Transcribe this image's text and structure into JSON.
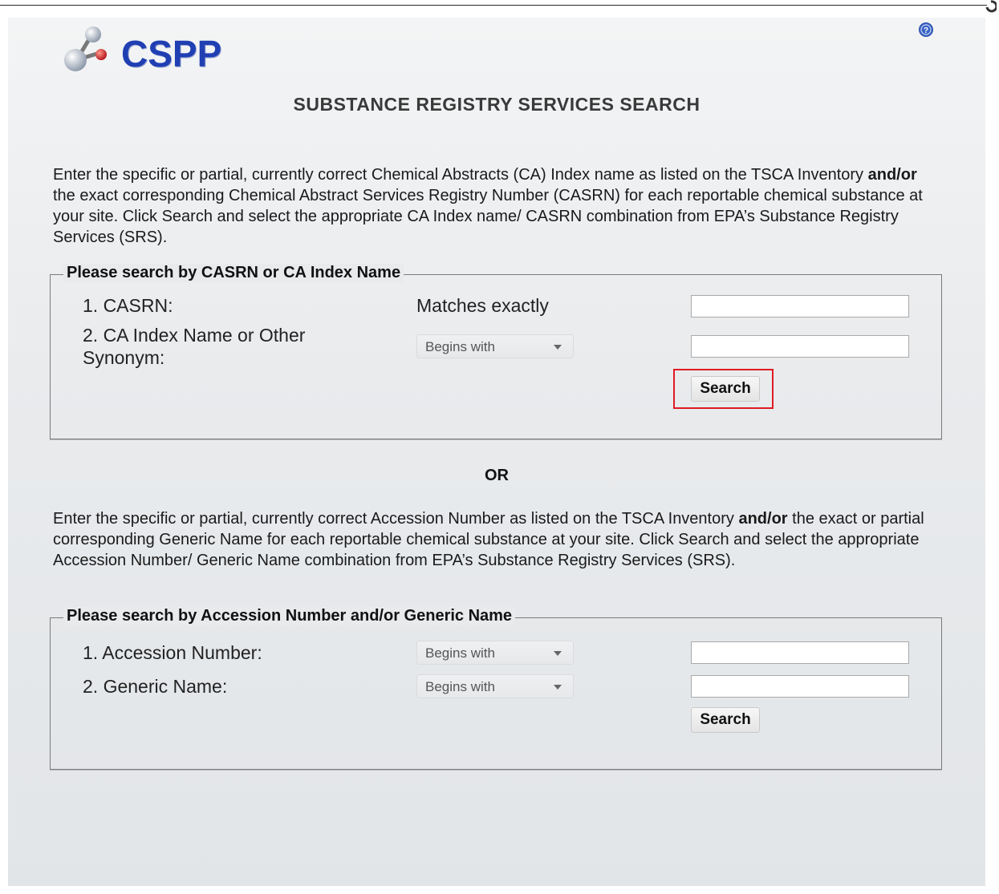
{
  "app": {
    "logo_text": "CSPP",
    "title": "SUBSTANCE REGISTRY SERVICES SEARCH",
    "help_icon": "help-icon"
  },
  "intro1": {
    "part1": "Enter the specific or partial, currently correct Chemical Abstracts (CA) Index name as listed on the TSCA Inventory ",
    "bold": "and/or",
    "part2": " the exact corresponding Chemical Abstract Services Registry Number (CASRN) for each reportable chemical substance at your site. Click Search and select the appropriate CA Index name/ CASRN combination from EPA’s Substance Registry Services (SRS)."
  },
  "casrn_search": {
    "legend": "Please search by CASRN or CA Index Name",
    "row1_label": "1. CASRN:",
    "row1_match": "Matches exactly",
    "row1_value": "",
    "row2_label": "2. CA Index Name or Other Synonym:",
    "row2_match": "Begins with",
    "row2_value": "",
    "search_label": "Search"
  },
  "or_text": "OR",
  "intro2": {
    "part1": "Enter the specific or partial, currently correct Accession Number as listed on the TSCA Inventory ",
    "bold": "and/or",
    "part2": " the exact or partial corresponding Generic Name for each reportable chemical substance at your site. Click Search and select the appropriate Accession Number/ Generic Name combination from EPA’s Substance Registry Services (SRS)."
  },
  "accession_search": {
    "legend": "Please search by Accession Number and/or Generic Name",
    "row1_label": "1. Accession Number:",
    "row1_match": "Begins with",
    "row1_value": "",
    "row2_label": "2. Generic Name:",
    "row2_match": "Begins with",
    "row2_value": "",
    "search_label": "Search"
  },
  "colors": {
    "logo_blue": "#1f3fb3",
    "highlight_red": "#e01b24",
    "panel_bg": "#e6e8ea"
  }
}
